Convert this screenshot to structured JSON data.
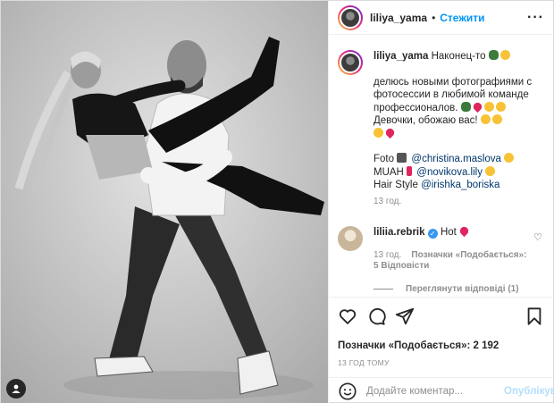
{
  "header": {
    "username": "liliya_yama",
    "separator": "•",
    "follow_label": "Стежити",
    "more_icon": "more-icon"
  },
  "caption": {
    "username": "liliya_yama",
    "line1": "Наконец-то",
    "line2": "делюсь новыми фотографиями с фотосессии в любимой команде профессионалов.",
    "line3": "Девочки, обожаю вас!",
    "credit_foto_label": "Foto",
    "credit_foto_user": "@christina.maslova",
    "credit_muah_label": "MUAH",
    "credit_muah_user": "@novikova.lily",
    "credit_hair_label": "Hair Style",
    "credit_hair_user": "@irishka_boriska",
    "time": "13 год."
  },
  "comment": {
    "username": "liliia.rebrik",
    "text": "Hot",
    "time": "13 год.",
    "likes": "Позначки «Подобається»: 5",
    "reply": "Відповісти",
    "view_replies": "Переглянути відповіді (1)"
  },
  "actions": {
    "likes_text": "Позначки «Подобається»: 2 192",
    "posted": "13 ГОД ТОМУ"
  },
  "add_comment": {
    "placeholder": "Додайте коментар...",
    "publish_label": "Опублікувати"
  },
  "colors": {
    "accent": "#0095f6",
    "publish_disabled": "#b2dffc",
    "heart": "#e0245e"
  }
}
